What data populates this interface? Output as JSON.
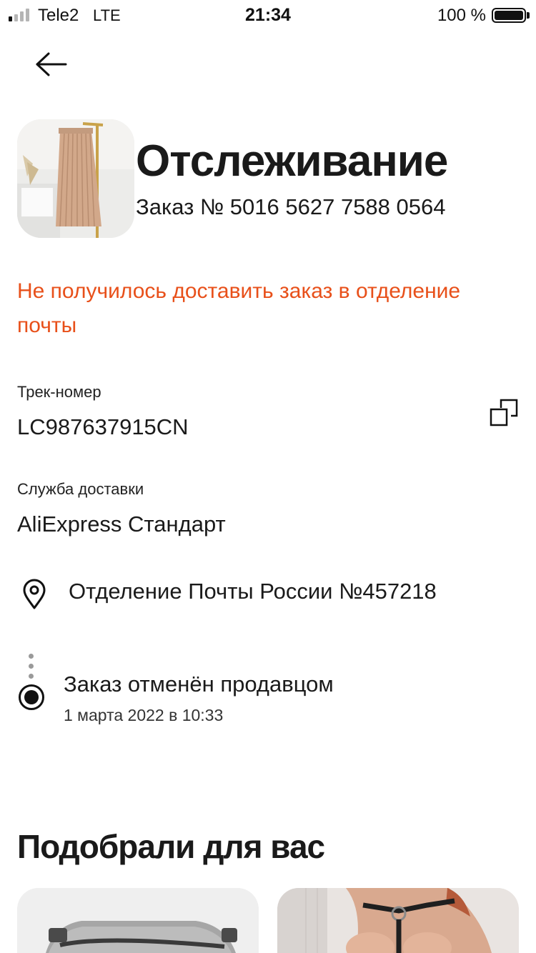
{
  "status_bar": {
    "carrier": "Tele2",
    "network": "LTE",
    "time": "21:34",
    "battery": "100 %",
    "battery_level": 1.0,
    "signal_bars_active": 1,
    "signal_bars_total": 4
  },
  "header": {
    "back_icon": "arrow-left-icon",
    "title": "Отслеживание",
    "order_number": "Заказ № 5016 5627 7588 0564"
  },
  "status_message": "Не получилось доставить заказ в отделение почты",
  "tracking": {
    "label": "Трек-номер",
    "value": "LC987637915CN",
    "copy_icon": "copy-icon"
  },
  "delivery": {
    "label": "Служба доставки",
    "value": "AliExpress Стандарт"
  },
  "address": {
    "icon": "location-pin-icon",
    "text": "Отделение Почты России №457218"
  },
  "timeline": {
    "event_title": "Заказ отменён продавцом",
    "event_time": "1 марта 2022 в 10:33"
  },
  "recommendations": {
    "title": "Подобрали для вас"
  },
  "colors": {
    "accent": "#e8501a",
    "text": "#1a1a1a"
  }
}
